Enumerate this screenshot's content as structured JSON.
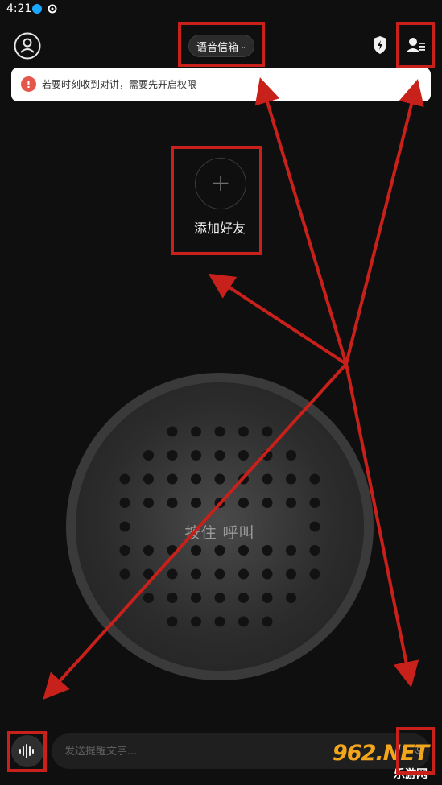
{
  "status_bar": {
    "time": "4:21",
    "icons": [
      "bluetooth-icon",
      "settings-icon"
    ]
  },
  "header": {
    "mailbox_label": "语音信箱",
    "icons": [
      "profile-icon",
      "shield-icon",
      "contacts-icon"
    ]
  },
  "notice": {
    "text": "若要时刻收到对讲，需要先开启权限",
    "arrow": "›"
  },
  "add_friend": {
    "plus": "+",
    "label": "添加好友"
  },
  "talk": {
    "label": "按住 呼叫"
  },
  "composer": {
    "placeholder": "发送提醒文字..."
  },
  "watermark": {
    "main": "962.NET",
    "sub": "乐游网"
  },
  "colors": {
    "annotation": "#c8201a",
    "warning": "#e5574b",
    "background": "#0f0f0f"
  }
}
